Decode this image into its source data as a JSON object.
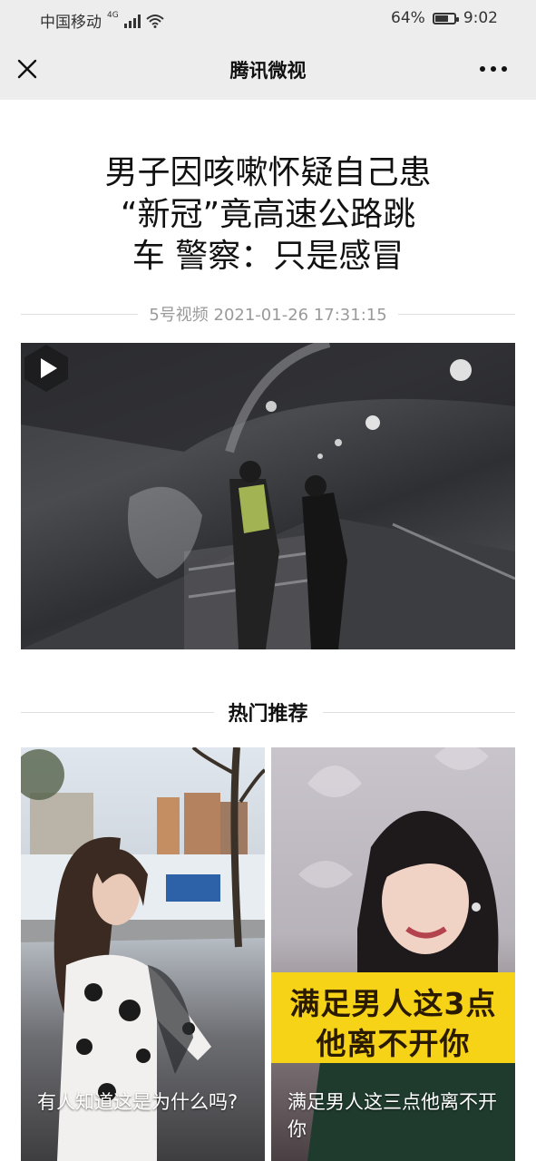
{
  "status_bar": {
    "carrier": "中国移动",
    "network": "4G",
    "battery": "64%",
    "battery_level": 0.64,
    "time": "9:02"
  },
  "nav": {
    "title": "腾讯微视",
    "close_icon": "close-icon",
    "more_icon": "more-icon"
  },
  "article": {
    "title_lines": [
      "男子因咳嗽怀疑自己患",
      "“新冠”竟高速公路跳",
      "车 警察：只是感冒"
    ],
    "meta": "5号视频 2021-01-26 17:31:15"
  },
  "video": {
    "play_icon": "play-icon"
  },
  "recommend": {
    "section_title": "热门推荐",
    "cards": [
      {
        "caption": "有人知道这是为什么吗?"
      },
      {
        "caption": "满足男人这三点他离不开你",
        "overlay_lines": [
          "满足男人这3点",
          "他离不开你"
        ]
      }
    ]
  },
  "colors": {
    "bar_bg": "#ededed",
    "overlay_yellow": "#f6d317"
  }
}
